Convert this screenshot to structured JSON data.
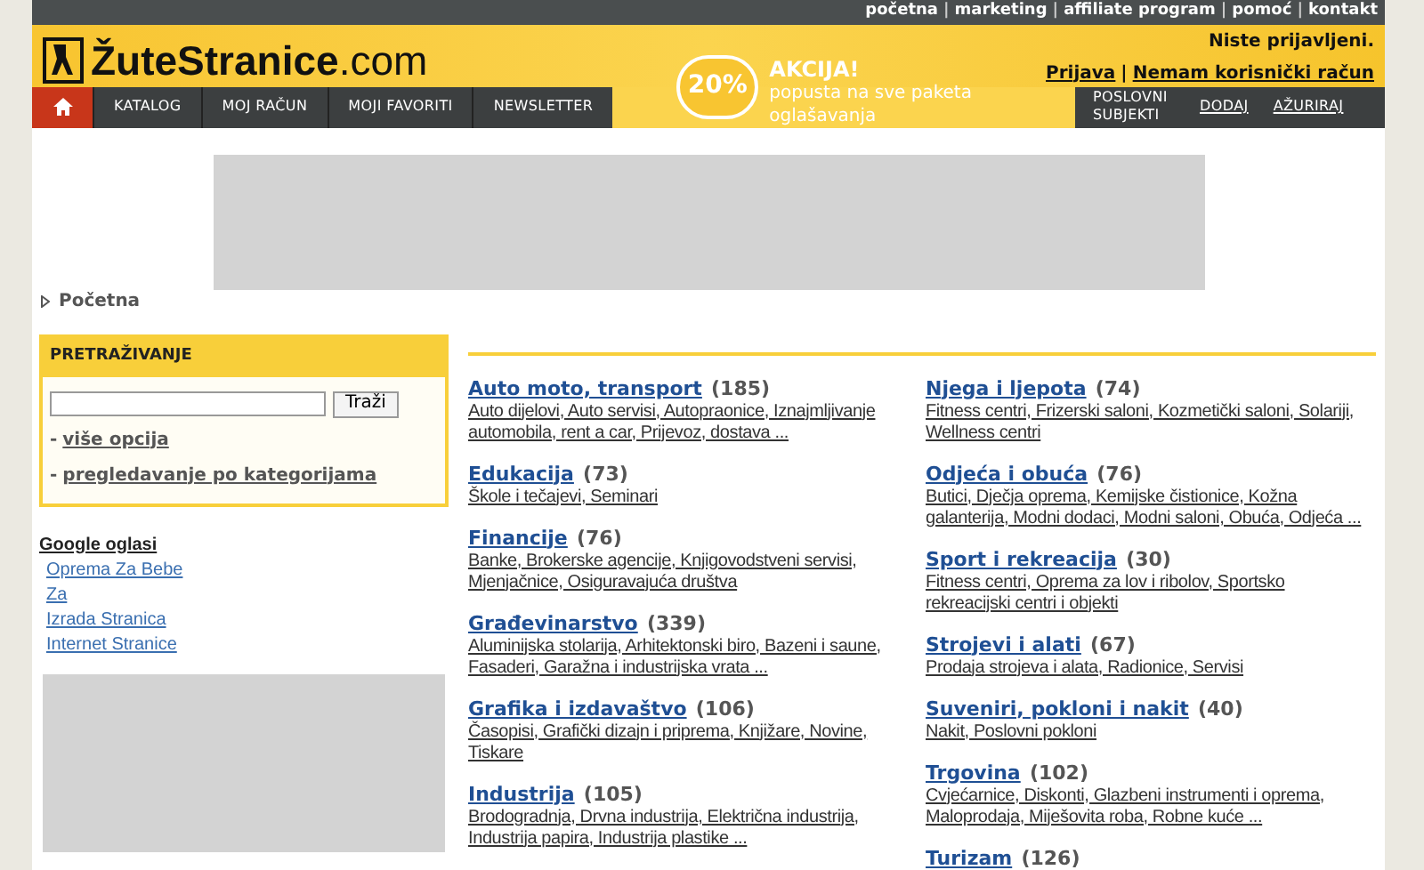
{
  "top_links": [
    "početna",
    "marketing",
    "affiliate program",
    "pomoć",
    "kontakt"
  ],
  "link_separator": "|",
  "logo": {
    "main": "ŽuteStranice",
    "suffix": ".com"
  },
  "login": {
    "status": "Niste prijavljeni.",
    "links": [
      "Prijava",
      "Nemam korisnički račun"
    ],
    "separator": "|"
  },
  "nav": [
    {
      "kind": "home",
      "selected": true
    },
    {
      "kind": "link",
      "label": "KATALOG",
      "selected": false
    },
    {
      "kind": "link",
      "label": "MOJ RAČUN",
      "selected": false
    },
    {
      "kind": "link",
      "label": "MOJI FAVORITI",
      "selected": false
    },
    {
      "kind": "link",
      "label": "NEWSLETTER",
      "selected": false
    }
  ],
  "promo": {
    "badge": "20%",
    "title": "AKCIJA!",
    "text": "popusta na sve paketa oglašavanja"
  },
  "business_nav": {
    "title": "POSLOVNI SUBJEKTI",
    "links": [
      "DODAJ",
      "AŽURIRAJ"
    ]
  },
  "breadcrumb": "Početna",
  "search": {
    "title": "PRETRAŽIVANJE",
    "button": "Traži",
    "bullet": "-",
    "links": [
      "više opcija",
      "pregledavanje po kategorijama"
    ]
  },
  "google_ads": {
    "title": "Google oglasi",
    "links": [
      "Oprema Za Bebe",
      "Za",
      "Izrada Stranica",
      "Internet Stranice"
    ]
  },
  "categories": [
    [
      {
        "name": "Auto moto, transport",
        "count": "(185)",
        "subs": "Auto dijelovi, Auto servisi, Autopraonice, Iznajmljivanje automobila, rent a car, Prijevoz, dostava ..."
      },
      {
        "name": "Edukacija",
        "count": "(73)",
        "subs": "Škole i tečajevi, Seminari"
      },
      {
        "name": "Financije",
        "count": "(76)",
        "subs": "Banke, Brokerske agencije, Knjigovodstveni servisi, Mjenjačnice, Osiguravajuća društva"
      },
      {
        "name": "Građevinarstvo",
        "count": "(339)",
        "subs": "Aluminijska stolarija, Arhitektonski biro, Bazeni i saune, Fasaderi, Garažna i industrijska vrata ..."
      },
      {
        "name": "Grafika i izdavaštvo",
        "count": "(106)",
        "subs": "Časopisi, Grafički dizajn i priprema, Knjižare, Novine, Tiskare"
      },
      {
        "name": "Industrija",
        "count": "(105)",
        "subs": "Brodogradnja, Drvna industrija, Električna industrija, Industrija papira, Industrija plastike ..."
      }
    ],
    [
      {
        "name": "Njega i ljepota",
        "count": "(74)",
        "subs": "Fitness centri, Frizerski saloni, Kozmetički saloni, Solariji, Wellness centri"
      },
      {
        "name": "Odjeća i obuća",
        "count": "(76)",
        "subs": "Butici, Dječja oprema, Kemijske čistionice, Kožna galanterija, Modni dodaci, Modni saloni, Obuća, Odjeća ..."
      },
      {
        "name": "Sport i rekreacija",
        "count": "(30)",
        "subs": "Fitness centri, Oprema za lov i ribolov, Sportsko rekreacijski centri i objekti"
      },
      {
        "name": "Strojevi i alati",
        "count": "(67)",
        "subs": "Prodaja strojeva i alata, Radionice, Servisi"
      },
      {
        "name": "Suveniri, pokloni i nakit",
        "count": "(40)",
        "subs": "Nakit, Poslovni pokloni"
      },
      {
        "name": "Trgovina",
        "count": "(102)",
        "subs": "Cvjećarnice, Diskonti, Glazbeni instrumenti i oprema, Maloprodaja, Miješovita roba, Robne kuće ..."
      },
      {
        "name": "Turizam",
        "count": "(126)"
      }
    ]
  ]
}
